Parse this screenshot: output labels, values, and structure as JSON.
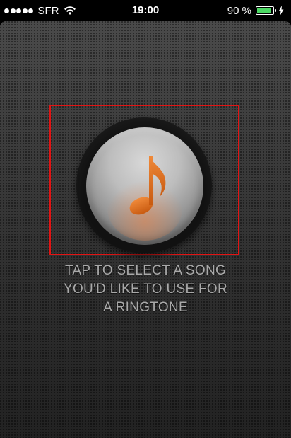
{
  "status_bar": {
    "carrier": "SFR",
    "time": "19:00",
    "battery_percent": "90 %",
    "battery_level": 0.9,
    "signal_strength": 5,
    "icons": [
      "signal-dots-icon",
      "wifi-icon",
      "battery-icon",
      "charging-icon"
    ]
  },
  "main": {
    "instruction_lines": [
      "TAP TO SELECT A SONG",
      "YOU'D LIKE TO USE FOR",
      "A RINGTONE"
    ],
    "button_icon": "music-note-icon"
  },
  "colors": {
    "highlight_border": "#e31414",
    "note_orange": "#e07020",
    "battery_green": "#4cd964",
    "text_gray": "#a9a9a9"
  }
}
